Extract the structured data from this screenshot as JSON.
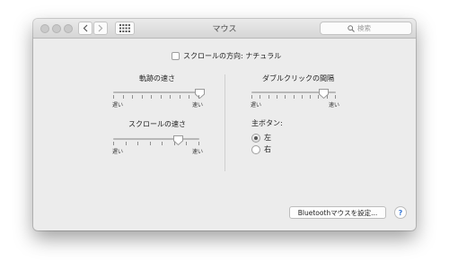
{
  "window": {
    "title": "マウス"
  },
  "toolbar": {
    "search_placeholder": "検索"
  },
  "scroll_direction": {
    "label": "スクロールの方向: ナチュラル",
    "checked": false
  },
  "tracking_speed": {
    "heading": "軌跡の速さ",
    "min_label": "遅い",
    "max_label": "速い",
    "level": 1.0,
    "ticks": 10
  },
  "scroll_speed": {
    "heading": "スクロールの速さ",
    "min_label": "遅い",
    "max_label": "速い",
    "level": 0.75,
    "ticks": 8
  },
  "double_click_speed": {
    "heading": "ダブルクリックの間隔",
    "min_label": "遅い",
    "max_label": "速い",
    "level": 0.85,
    "ticks": 11
  },
  "primary_button": {
    "heading": "主ボタン:",
    "options": [
      "左",
      "右"
    ],
    "selected": "左"
  },
  "footer": {
    "bluetooth_button": "Bluetoothマウスを設定...",
    "help_label": "?"
  },
  "colors": {
    "window_bg": "#ececec",
    "help_accent": "#3b7bd8"
  }
}
